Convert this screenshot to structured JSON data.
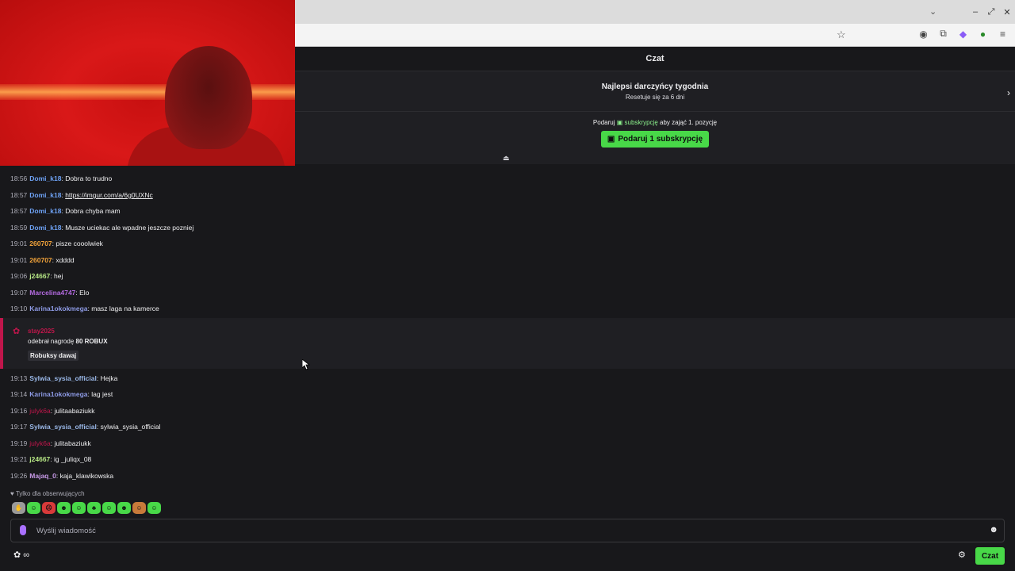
{
  "browser": {
    "window_controls": [
      "–",
      "⤢",
      "✕"
    ],
    "chevron": "⌄"
  },
  "chat": {
    "header_title": "Czat",
    "leaderboard": {
      "title": "Najlepsi darczyńcy tygodnia",
      "subtitle": "Resetuje się za 6 dni"
    },
    "gift": {
      "line_prefix": "Podaruj",
      "line_highlight": "subskrypcję",
      "line_suffix": "aby zająć 1. pozycję",
      "button_label": "Podaruj 1 subskrypcję"
    },
    "messages": [
      {
        "time": "18:56",
        "user": "Domi_k18",
        "color": "#6ea2f5",
        "text": "Dobra to trudno"
      },
      {
        "time": "18:57",
        "user": "Domi_k18",
        "color": "#6ea2f5",
        "text": "https://imgur.com/a/6g0UXNc",
        "link": true
      },
      {
        "time": "18:57",
        "user": "Domi_k18",
        "color": "#6ea2f5",
        "text": "Dobra chyba mam"
      },
      {
        "time": "18:59",
        "user": "Domi_k18",
        "color": "#6ea2f5",
        "text": "Musze uciekac ale wpadne jeszcze pozniej"
      },
      {
        "time": "19:01",
        "user": "260707",
        "color": "#f2a33a",
        "text": "pisze cooolwiek"
      },
      {
        "time": "19:01",
        "user": "260707",
        "color": "#f2a33a",
        "text": "xdddd"
      },
      {
        "time": "19:06",
        "user": "j24667",
        "color": "#b8e986",
        "text": "hej"
      },
      {
        "time": "19:07",
        "user": "Marcelina4747",
        "color": "#b36ae0",
        "text": "Elo"
      },
      {
        "time": "19:10",
        "user": "Karina1okokmega",
        "color": "#8e9be6",
        "text": "masz laga na kamerce"
      }
    ],
    "reward": {
      "user": "stay2025",
      "line_prefix": "odebrał nagrodę",
      "reward_name": "80 ROBUX",
      "message": "Robuksy dawaj"
    },
    "messages2": [
      {
        "time": "19:13",
        "user": "Sylwia_sysia_official",
        "color": "#9ab8e8",
        "text": "Hejka"
      },
      {
        "time": "19:14",
        "user": "Karina1okokmega",
        "color": "#8e9be6",
        "text": "lag jest"
      },
      {
        "time": "19:16",
        "user": "julyk6a",
        "color": "#c0164b",
        "text": "julitaabaziukk"
      },
      {
        "time": "19:17",
        "user": "Sylwia_sysia_official",
        "color": "#9ab8e8",
        "text": "sylwia_sysia_official"
      },
      {
        "time": "19:19",
        "user": "julyk6a",
        "color": "#c0164b",
        "text": "julitabaziukk"
      },
      {
        "time": "19:21",
        "user": "j24667",
        "color": "#b8e986",
        "text": "ig _juliqx_08"
      },
      {
        "time": "19:26",
        "user": "Majaq_0",
        "color": "#c89ae8",
        "text": "kaja_klawikowska"
      }
    ],
    "followers_only": "Tylko dla obserwujących",
    "emote_colors": [
      "#9a9a9a",
      "#48d848",
      "#d83a3a",
      "#48d848",
      "#48d848",
      "#48d848",
      "#48d848",
      "#48d848",
      "#c87a3a",
      "#48d848"
    ],
    "input_placeholder": "Wyślij wiadomość",
    "send_button": "Czat",
    "bottom_left": "∞"
  }
}
